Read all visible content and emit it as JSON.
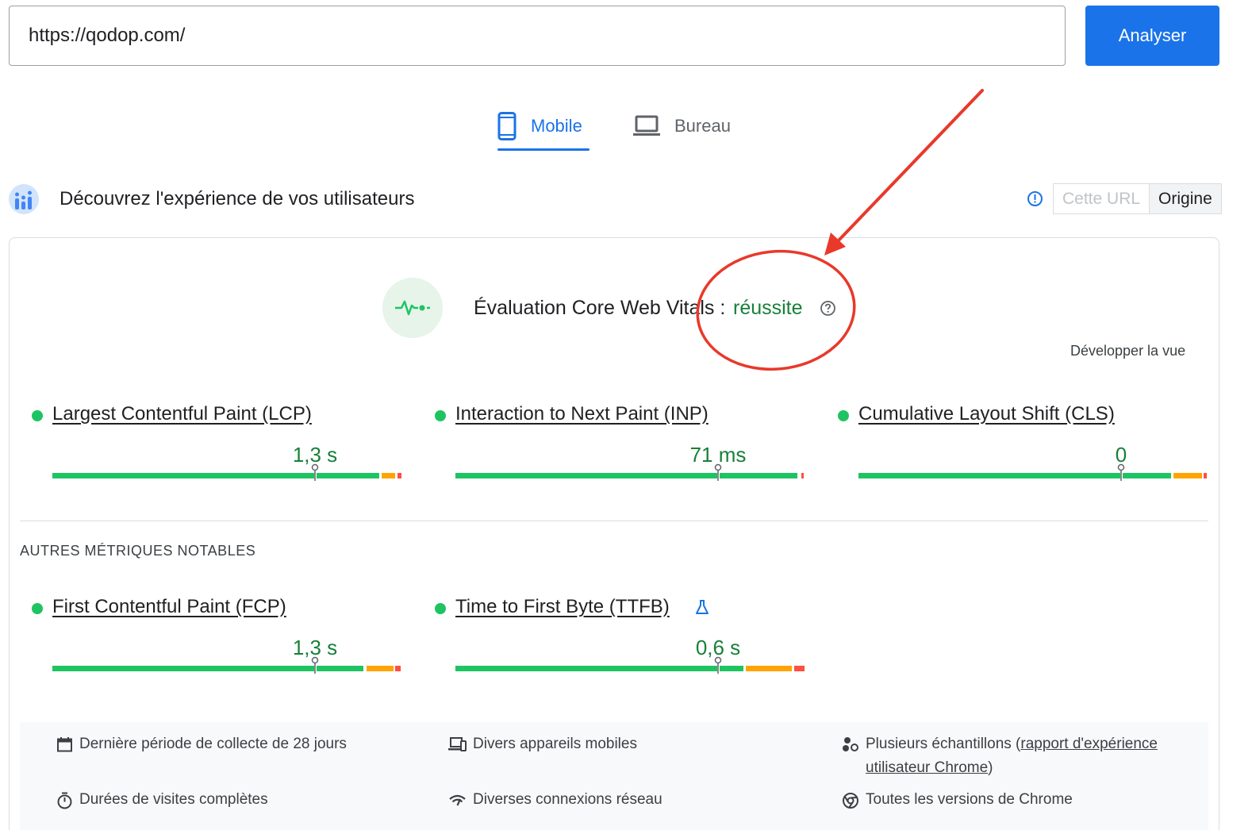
{
  "search": {
    "url": "https://qodop.com/",
    "analyze_label": "Analyser"
  },
  "tabs": [
    {
      "label": "Mobile",
      "active": true
    },
    {
      "label": "Bureau",
      "active": false
    }
  ],
  "section": {
    "title": "Découvrez l'expérience de vos utilisateurs",
    "toggle": {
      "url_label": "Cette URL",
      "origin_label": "Origine"
    }
  },
  "assessment": {
    "title": "Évaluation Core Web Vitals :",
    "status": "réussite",
    "expand_label": "Développer la vue"
  },
  "core_metrics": [
    {
      "name": "Largest Contentful Paint (LCP)",
      "value": "1,3 s",
      "status": "good"
    },
    {
      "name": "Interaction to Next Paint (INP)",
      "value": "71 ms",
      "status": "good"
    },
    {
      "name": "Cumulative Layout Shift (CLS)",
      "value": "0",
      "status": "good"
    }
  ],
  "other_section_title": "AUTRES MÉTRIQUES NOTABLES",
  "other_metrics": [
    {
      "name": "First Contentful Paint (FCP)",
      "value": "1,3 s",
      "status": "good"
    },
    {
      "name": "Time to First Byte (TTFB)",
      "value": "0,6 s",
      "status": "good",
      "experimental": true
    }
  ],
  "footer": {
    "period": "Dernière période de collecte de 28 jours",
    "devices": "Divers appareils mobiles",
    "samples_prefix": "Plusieurs échantillons (",
    "samples_link": "rapport d'expérience utilisateur Chrome",
    "samples_suffix": ")",
    "durations": "Durées de visites complètes",
    "network": "Diverses connexions réseau",
    "chrome": "Toutes les versions de Chrome"
  },
  "colors": {
    "accent": "#1a73e8",
    "good": "#1fc462",
    "good_text": "#188038",
    "needs_improvement": "#ffa400",
    "poor": "#ff4e42",
    "annotation": "#e8392b"
  }
}
